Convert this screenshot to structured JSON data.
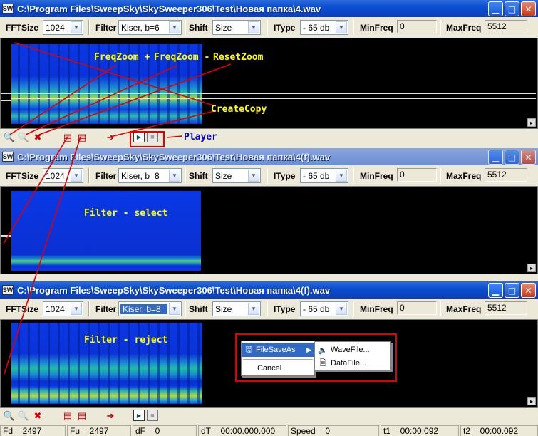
{
  "windows": [
    {
      "title": "C:\\Program Files\\SweepSky\\SkySweeper306\\Test\\Новая папка\\4.wav",
      "app_icon": "SW",
      "toolbar": {
        "fftsize_label": "FFTSize",
        "fftsize_value": "1024",
        "filter_label": "Filter",
        "filter_value": "Kiser, b=6",
        "shift_label": "Shift",
        "shift_value": "Size",
        "itype_label": "IType",
        "itype_value": "- 65 db",
        "minfreq_label": "MinFreq",
        "minfreq_value": "0",
        "maxfreq_label": "MaxFreq",
        "maxfreq_value": "5512"
      }
    },
    {
      "title": "C:\\Program Files\\SweepSky\\SkySweeper306\\Test\\Новая папка\\4(f).wav",
      "app_icon": "SW",
      "toolbar": {
        "fftsize_label": "FFTSize",
        "fftsize_value": "1024",
        "filter_label": "Filter",
        "filter_value": "Kiser, b=8",
        "shift_label": "Shift",
        "shift_value": "Size",
        "itype_label": "IType",
        "itype_value": "- 65 db",
        "minfreq_label": "MinFreq",
        "minfreq_value": "0",
        "maxfreq_label": "MaxFreq",
        "maxfreq_value": "5512"
      }
    },
    {
      "title": "C:\\Program Files\\SweepSky\\SkySweeper306\\Test\\Новая папка\\4(f).wav",
      "app_icon": "SW",
      "toolbar": {
        "fftsize_label": "FFTSize",
        "fftsize_value": "1024",
        "filter_label": "Filter",
        "filter_value": "Kiser, b=8",
        "shift_label": "Shift",
        "shift_value": "Size",
        "itype_label": "IType",
        "itype_value": "- 65 db",
        "minfreq_label": "MinFreq",
        "minfreq_value": "0",
        "maxfreq_label": "MaxFreq",
        "maxfreq_value": "5512"
      }
    }
  ],
  "annotations": {
    "freqzoom_plus": "FreqZoom +",
    "freqzoom_minus": "FreqZoom -",
    "reset_zoom": "ResetZoom",
    "create_copy": "CreateCopy",
    "player": "Player",
    "filter_select": "Filter - select",
    "filter_reject": "Filter - reject"
  },
  "context_menu": {
    "file_save_as": "FileSaveAs",
    "cancel": "Cancel",
    "wave_file": "WaveFile...",
    "data_file": "DataFile..."
  },
  "status": {
    "fd": "Fd = 2497",
    "fu": "Fu = 2497",
    "df": "dF = 0",
    "dt": "dT = 00:00.000.000",
    "speed": "Speed = 0",
    "t1": "t1 = 00:00.092",
    "t2": "t2 = 00:00.092"
  },
  "colors": {
    "annotation_yellow": "#ffff00",
    "annotation_blue": "#0000c0",
    "annotation_red": "#e00000",
    "title_bar": "#0a4fd4"
  },
  "icons": [
    "zoom-in-icon",
    "zoom-out-icon",
    "reset-zoom-icon",
    "create-copy-icon",
    "filter-select-icon",
    "filter-reject-icon",
    "save-icon",
    "play-icon",
    "stop-icon",
    "speaker-icon",
    "document-icon"
  ]
}
